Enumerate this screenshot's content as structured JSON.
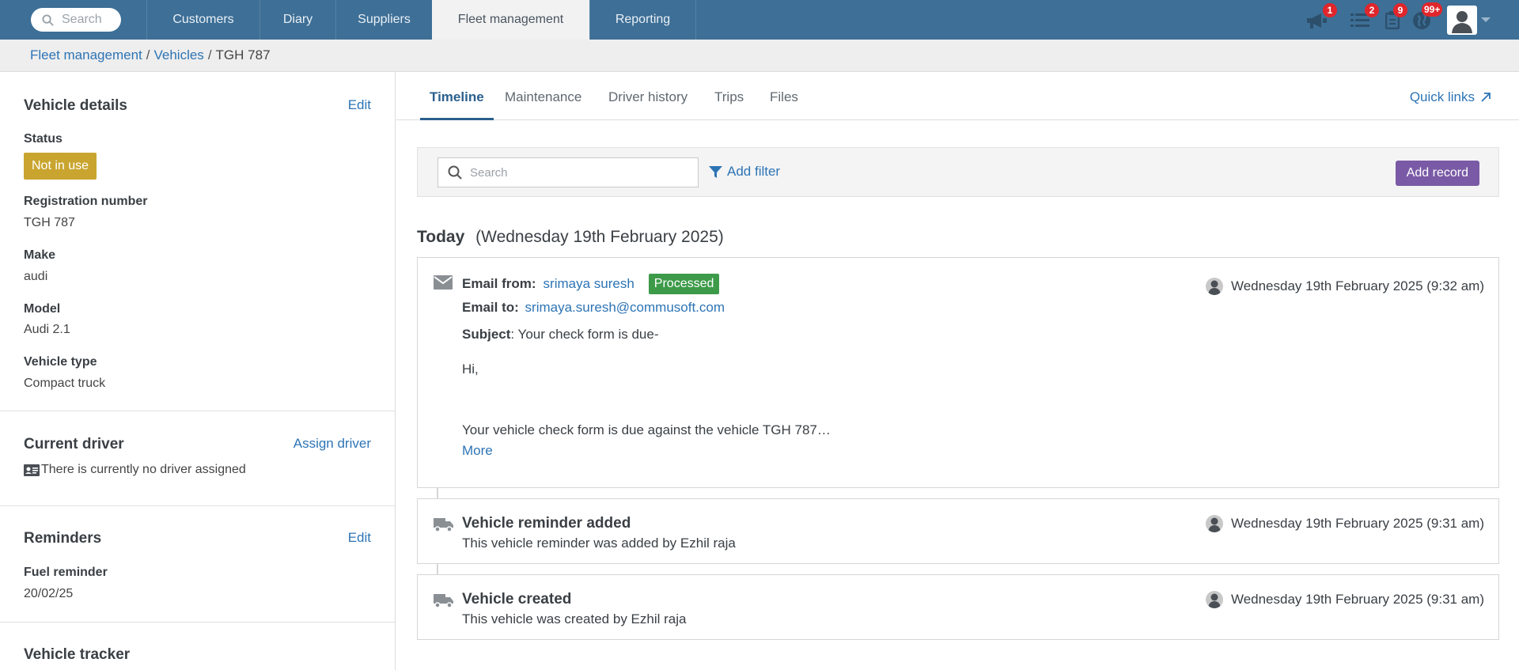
{
  "nav": {
    "search_placeholder": "Search",
    "items": [
      "Customers",
      "Diary",
      "Suppliers",
      "Fleet management",
      "Reporting"
    ],
    "active": "Fleet management",
    "badges": {
      "announcements": "1",
      "tasks": "2",
      "clipboard": "9",
      "globe": "99+"
    }
  },
  "breadcrumb": {
    "items": [
      "Fleet management",
      "Vehicles"
    ],
    "separator": "/",
    "current": "TGH 787"
  },
  "vehicle_details": {
    "title": "Vehicle details",
    "edit": "Edit",
    "status_label": "Status",
    "status_value": "Not in use",
    "registration_label": "Registration number",
    "registration_value": "TGH 787",
    "make_label": "Make",
    "make_value": "audi",
    "model_label": "Model",
    "model_value": "Audi 2.1",
    "type_label": "Vehicle type",
    "type_value": "Compact truck"
  },
  "current_driver": {
    "title": "Current driver",
    "action": "Assign driver",
    "message": "There is currently no driver assigned"
  },
  "reminders": {
    "title": "Reminders",
    "edit": "Edit",
    "fuel_label": "Fuel reminder",
    "fuel_value": "20/02/25"
  },
  "vehicle_tracker": {
    "title": "Vehicle tracker"
  },
  "tabs": [
    "Timeline",
    "Maintenance",
    "Driver history",
    "Trips",
    "Files"
  ],
  "active_tab": "Timeline",
  "quick_links": "Quick links",
  "filter": {
    "search_placeholder": "Search",
    "add_filter": "Add filter",
    "add_record": "Add record"
  },
  "timeline": {
    "day_label": "Today",
    "day_date": "(Wednesday 19th February 2025)",
    "email": {
      "from_label": "Email from:",
      "from_value": "srimaya suresh",
      "status": "Processed",
      "to_label": "Email to:",
      "to_value": "srimaya.suresh@commusoft.com",
      "subject_label": "Subject",
      "subject_value": ": Your check form is due-",
      "greeting": "Hi,",
      "body": "Your vehicle check form is due against the vehicle TGH 787…",
      "more": "More",
      "time": "Wednesday 19th February 2025 (9:32 am)"
    },
    "reminder": {
      "title": "Vehicle reminder added",
      "sub": "This vehicle reminder was added by Ezhil raja",
      "time": "Wednesday 19th February 2025 (9:31 am)"
    },
    "created": {
      "title": "Vehicle created",
      "sub": "This vehicle was created by Ezhil raja",
      "time": "Wednesday 19th February 2025 (9:31 am)"
    }
  },
  "colors": {
    "nav_bg": "#3e6f96",
    "link": "#2d74b5",
    "status_chip": "#c9a530",
    "processed": "#3d9a49",
    "add_record": "#7a5aa6",
    "badge": "#e0262b"
  }
}
